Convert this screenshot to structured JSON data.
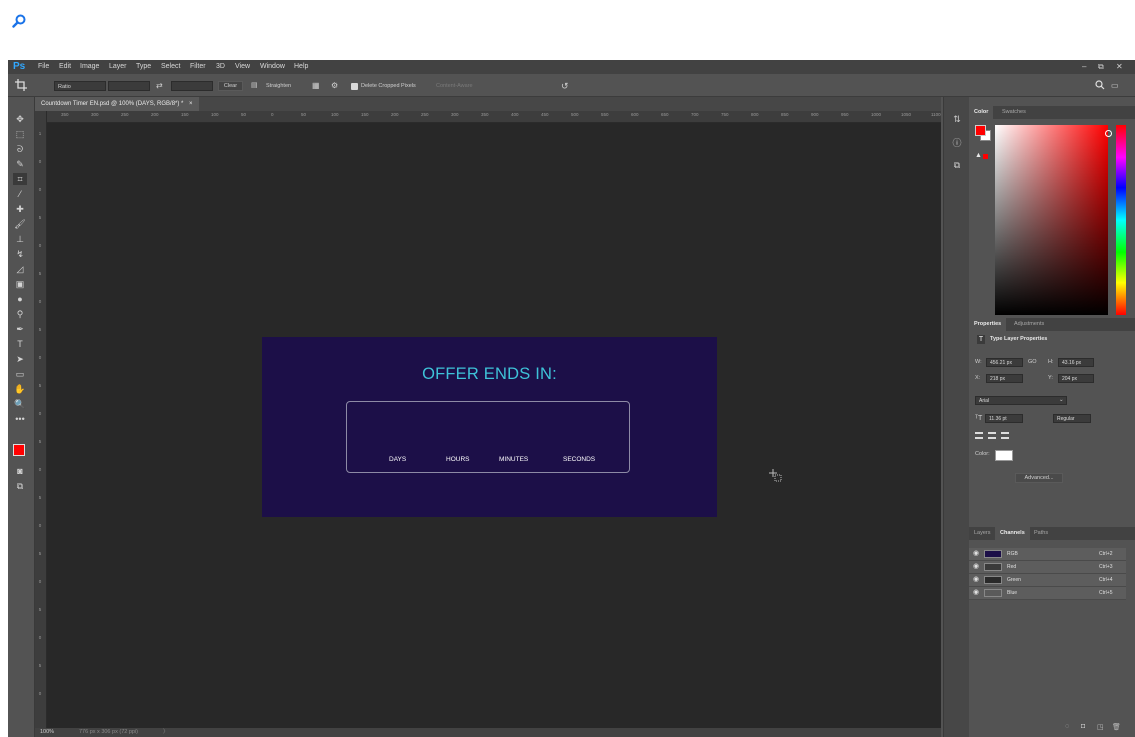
{
  "outer": {
    "search_icon": "search-icon"
  },
  "app": {
    "logo": "Ps",
    "menus": [
      "File",
      "Edit",
      "Image",
      "Layer",
      "Type",
      "Select",
      "Filter",
      "3D",
      "View",
      "Window",
      "Help"
    ],
    "window_controls": {
      "minimize": "–",
      "restore": "⧉",
      "close": "✕"
    }
  },
  "options": {
    "ratio_label": "Ratio",
    "clear_label": "Clear",
    "straighten_label": "Straighten",
    "delete_cropped_label": "Delete Cropped Pixels",
    "delete_cropped_checked": true,
    "content_aware_label": "Content-Aware",
    "reset_icon": "↺"
  },
  "document": {
    "tab_title": "Countdown Timer EN.psd @ 100% (DAYS, RGB/8*) *",
    "close_icon": "×",
    "zoom": "100%",
    "doc_info": "776 px x 306 px (72 ppi)",
    "status_arrow": "〉"
  },
  "ruler": {
    "h_ticks": [
      "350",
      "300",
      "250",
      "200",
      "150",
      "100",
      "50",
      "0",
      "50",
      "100",
      "150",
      "200",
      "250",
      "300",
      "350",
      "400",
      "450",
      "500",
      "550",
      "600",
      "650",
      "700",
      "750",
      "800",
      "850",
      "900",
      "950",
      "1000",
      "1050",
      "1100"
    ],
    "v_ticks": [
      "1",
      "0",
      "0",
      "5",
      "0",
      "5",
      "0",
      "5",
      "0",
      "5",
      "0",
      "5",
      "0",
      "5",
      "0",
      "5",
      "0",
      "5",
      "0",
      "5",
      "0"
    ]
  },
  "artboard": {
    "title": "OFFER ENDS IN:",
    "labels": [
      "DAYS",
      "HOURS",
      "MINUTES",
      "SECONDS"
    ],
    "bg_color": "#1c0f48",
    "title_color": "#3ec2d8"
  },
  "color_panel": {
    "tabs": [
      "Color",
      "Swatches"
    ],
    "foreground": "#ff0000",
    "background": "#ffffff"
  },
  "properties_panel": {
    "tabs": [
      "Properties",
      "Adjustments"
    ],
    "header": "Type Layer Properties",
    "w_label": "W:",
    "w_value": "456.21 px",
    "link_label": "GO",
    "h_label": "H:",
    "h_value": "43.16 px",
    "x_label": "X:",
    "x_value": "218 px",
    "y_label": "Y:",
    "y_value": "204 px",
    "font_family": "Arial",
    "font_size": "11.36 pt",
    "font_style": "Regular",
    "color_label": "Color:",
    "text_color": "#ffffff",
    "advanced_label": "Advanced..."
  },
  "channels_panel": {
    "tabs": [
      "Layers",
      "Channels",
      "Paths"
    ],
    "rows": [
      {
        "name": "RGB",
        "shortcut": "Ctrl+2",
        "thumb": "#1c0f48"
      },
      {
        "name": "Red",
        "shortcut": "Ctrl+3",
        "thumb": "#3a3a3a"
      },
      {
        "name": "Green",
        "shortcut": "Ctrl+4",
        "thumb": "#2a2a2a"
      },
      {
        "name": "Blue",
        "shortcut": "Ctrl+5",
        "thumb": "#5a5a5a"
      }
    ]
  }
}
